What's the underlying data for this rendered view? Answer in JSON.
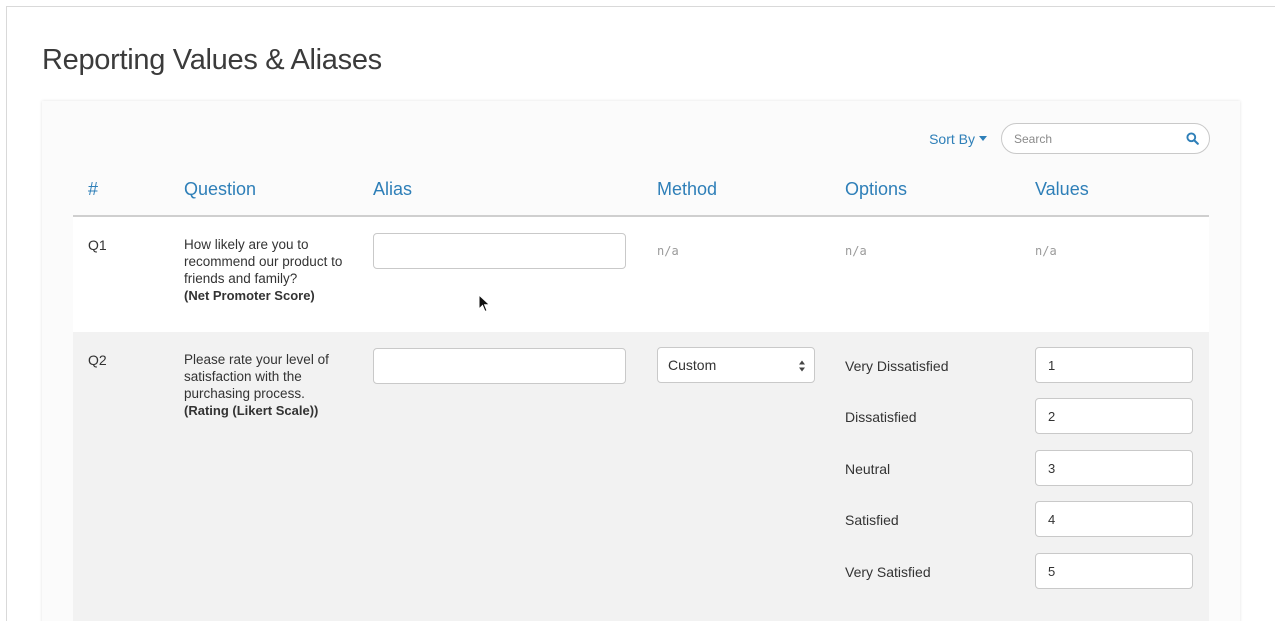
{
  "page": {
    "title": "Reporting Values & Aliases"
  },
  "toolbar": {
    "sort_label": "Sort By",
    "search_placeholder": "Search"
  },
  "columns": [
    "#",
    "Question",
    "Alias",
    "Method",
    "Options",
    "Values"
  ],
  "questions": [
    {
      "number": "Q1",
      "text": "How likely are you to recommend our product to friends and family?",
      "type": "(Net Promoter Score)",
      "alias": "",
      "method": "n/a",
      "options": "n/a",
      "values": "n/a"
    },
    {
      "number": "Q2",
      "text": "Please rate your level of satisfaction with the purchasing process.",
      "type": "(Rating (Likert Scale))",
      "alias": "",
      "method": "Custom",
      "options": [
        {
          "label": "Very Dissatisfied",
          "value": "1"
        },
        {
          "label": "Dissatisfied",
          "value": "2"
        },
        {
          "label": "Neutral",
          "value": "3"
        },
        {
          "label": "Satisfied",
          "value": "4"
        },
        {
          "label": "Very Satisfied",
          "value": "5"
        }
      ]
    }
  ],
  "colors": {
    "accent": "#2e7fb8",
    "muted": "#9a9a9a",
    "row_alt": "#f2f2f2"
  }
}
